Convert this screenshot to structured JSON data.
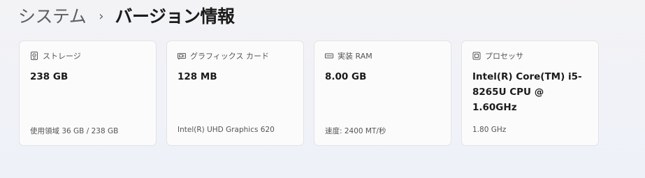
{
  "breadcrumb": {
    "parent": "システム",
    "separator": "›",
    "current": "バージョン情報"
  },
  "cards": [
    {
      "icon": "storage-drive-icon",
      "title": "ストレージ",
      "value": "238 GB",
      "sub": "使用領域 36 GB / 238 GB"
    },
    {
      "icon": "graphics-card-icon",
      "title": "グラフィックス カード",
      "value": "128 MB",
      "sub": "Intel(R) UHD Graphics 620"
    },
    {
      "icon": "memory-ram-icon",
      "title": "実装 RAM",
      "value": "8.00 GB",
      "sub": "速度: 2400 MT/秒"
    },
    {
      "icon": "processor-icon",
      "title": "プロセッサ",
      "value": "Intel(R) Core(TM) i5-8265U CPU @ 1.60GHz",
      "sub": "1.80 GHz"
    }
  ]
}
